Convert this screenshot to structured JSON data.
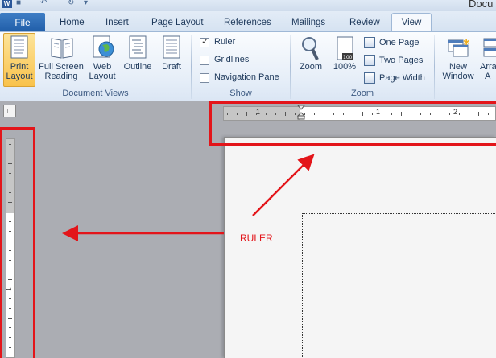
{
  "window": {
    "title": "Docu"
  },
  "tabs": {
    "file": "File",
    "home": "Home",
    "insert": "Insert",
    "page_layout": "Page Layout",
    "references": "References",
    "mailings": "Mailings",
    "review": "Review",
    "view": "View"
  },
  "ribbon": {
    "document_views": {
      "label": "Document Views",
      "print_layout": [
        "Print",
        "Layout"
      ],
      "full_screen_reading": [
        "Full Screen",
        "Reading"
      ],
      "web_layout": [
        "Web",
        "Layout"
      ],
      "outline": "Outline",
      "draft": "Draft"
    },
    "show": {
      "label": "Show",
      "ruler": "Ruler",
      "ruler_checked": true,
      "gridlines": "Gridlines",
      "gridlines_checked": false,
      "navigation_pane": "Navigation Pane",
      "navigation_pane_checked": false
    },
    "zoom": {
      "label": "Zoom",
      "zoom": "Zoom",
      "hundred": "100%",
      "one_page": "One Page",
      "two_pages": "Two Pages",
      "page_width": "Page Width"
    },
    "window": {
      "new_window": [
        "New",
        "Window"
      ],
      "arrange_partial": [
        "Arra",
        "A"
      ]
    }
  },
  "ruler": {
    "horizontal_numbers": [
      "1",
      "1",
      "2"
    ],
    "vertical_numbers": [
      "1"
    ]
  },
  "annotation": {
    "label": "RULER"
  },
  "colors": {
    "annotation": "#e3151a",
    "file_tab": "#2b6cb6",
    "active_view": "#f9c24b"
  }
}
